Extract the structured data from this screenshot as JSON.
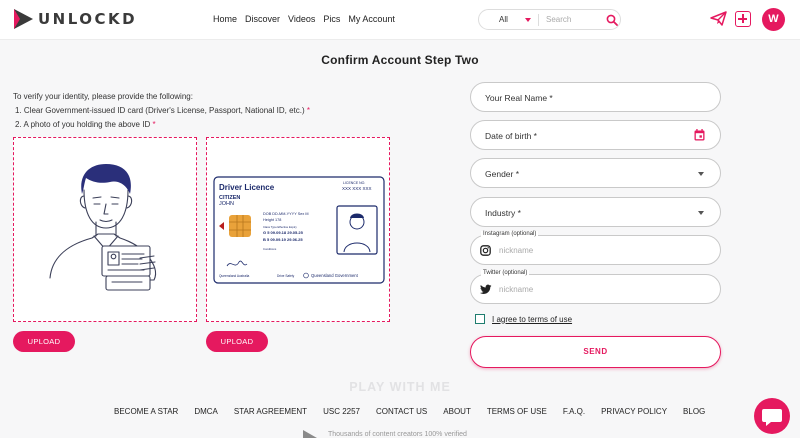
{
  "header": {
    "logo_text": "UNLOCKD",
    "nav": [
      "Home",
      "Discover",
      "Videos",
      "Pics",
      "My Account"
    ],
    "search": {
      "category": "All",
      "placeholder": "Search"
    },
    "avatar_initial": "W"
  },
  "page": {
    "title": "Confirm Account Step Two"
  },
  "instructions": {
    "intro": "To verify your identity, please provide the following:",
    "items": [
      {
        "text": "1. Clear Government-issued ID card (Driver's License, Passport, National ID, etc.)",
        "required": "*"
      },
      {
        "text": "2. A photo of you holding the above ID",
        "required": "*"
      }
    ]
  },
  "upload": {
    "button_label": "UPLOAD"
  },
  "id_card": {
    "title": "Driver Licence",
    "licence_no_label": "LICENCE NO.",
    "licence_no": "XXX XXX XXX",
    "surname": "CITIZEN",
    "given_name": "JOHN",
    "dob_line": "DOB DD-MM-YYYY  Sex M",
    "height_line": "Height 178",
    "class_header": "Class  Type  Effective   Expiry",
    "row1": "G   5   09.09.18   29.05.25",
    "row2": "B   5   09.09.19   29.06.25",
    "conditions": "Conditions",
    "footer_left": "Queensland Australia",
    "footer_mid": "Drive Safely",
    "footer_right": "Queensland Government"
  },
  "form": {
    "real_name": "Your Real Name *",
    "dob": "Date of birth *",
    "gender": "Gender *",
    "industry": "Industry *",
    "instagram_label": "Instagram (optional)",
    "instagram_placeholder": "nickname",
    "twitter_label": "Twitter (optional)",
    "twitter_placeholder": "nickname",
    "terms": "I agree to terms of use",
    "send": "SEND"
  },
  "footer": {
    "tagline": "PLAY WITH ME",
    "links": [
      "BECOME A STAR",
      "DMCA",
      "STAR AGREEMENT",
      "USC 2257",
      "CONTACT US",
      "ABOUT",
      "TERMS OF USE",
      "F.A.Q.",
      "PRIVACY POLICY",
      "BLOG"
    ],
    "bottom_text": "Thousands of content creators 100% verified"
  },
  "colors": {
    "accent": "#e5195f",
    "checkbox": "#1f7d6f",
    "card_blue": "#1c2a6b"
  }
}
